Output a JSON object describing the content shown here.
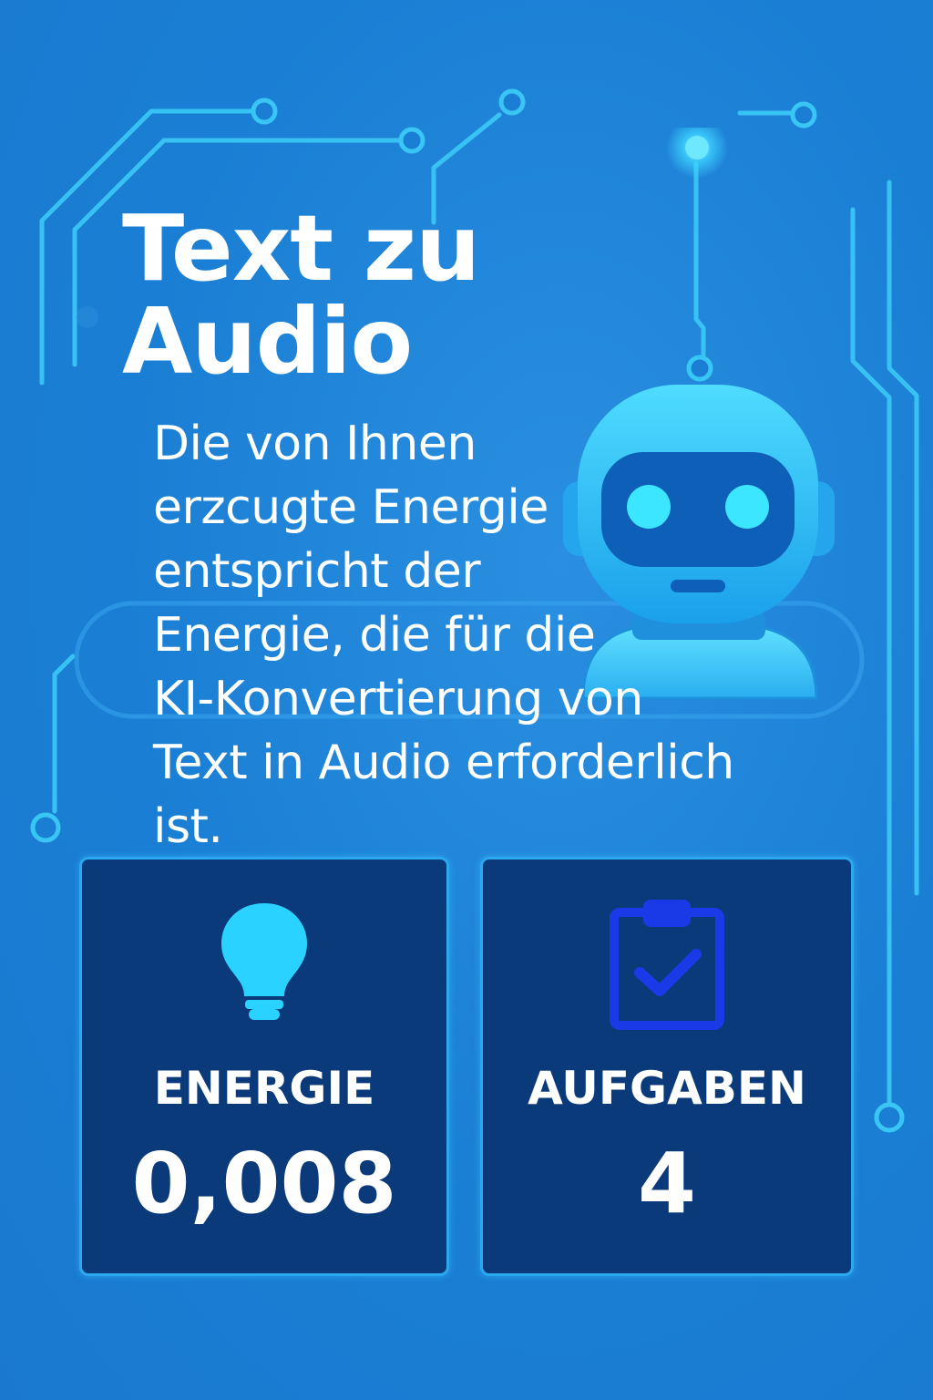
{
  "title": {
    "line1": "Text zu",
    "line2": "Audio"
  },
  "description": {
    "lines": [
      "Die von Ihnen",
      "erzcugte Energie",
      "entspricht der",
      "Energie, die für die",
      "KI-Konvertierung von",
      "Text in Audio erforderlich",
      "ist."
    ]
  },
  "stats": {
    "energy": {
      "icon": "lightbulb-icon",
      "label": "ENERGIE",
      "value": "0,008"
    },
    "tasks": {
      "icon": "clipboard-check-icon",
      "label": "AUFGABEN",
      "value": "4"
    }
  },
  "colors": {
    "background": "#1a7fd4",
    "card": "#0b3a7a",
    "accent": "#3cd2ff",
    "circuit": "#39c6f5",
    "clipboard": "#1a3ae8"
  }
}
